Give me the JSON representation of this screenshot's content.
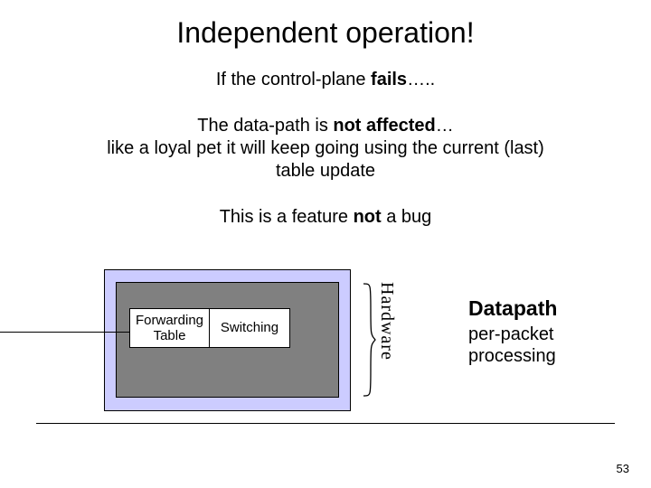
{
  "title": "Independent operation!",
  "line1_pre": "If the control-plane ",
  "line1_bold": "fails",
  "line1_post": "…..",
  "line2_pre": "The data-path is ",
  "line2_bold": "not affected",
  "line2_post": "…",
  "line3": "like a loyal pet it will keep going using the current (last)",
  "line4": "table update",
  "line5_pre": "This is a feature ",
  "line5_bold": "not",
  "line5_post": " a bug",
  "diagram": {
    "forwarding_cell": "Forwarding\nTable",
    "switching_cell": "Switching",
    "hardware_label": "Hardware",
    "datapath_title": "Datapath",
    "datapath_sub": "per-packet processing"
  },
  "page_number": "53"
}
